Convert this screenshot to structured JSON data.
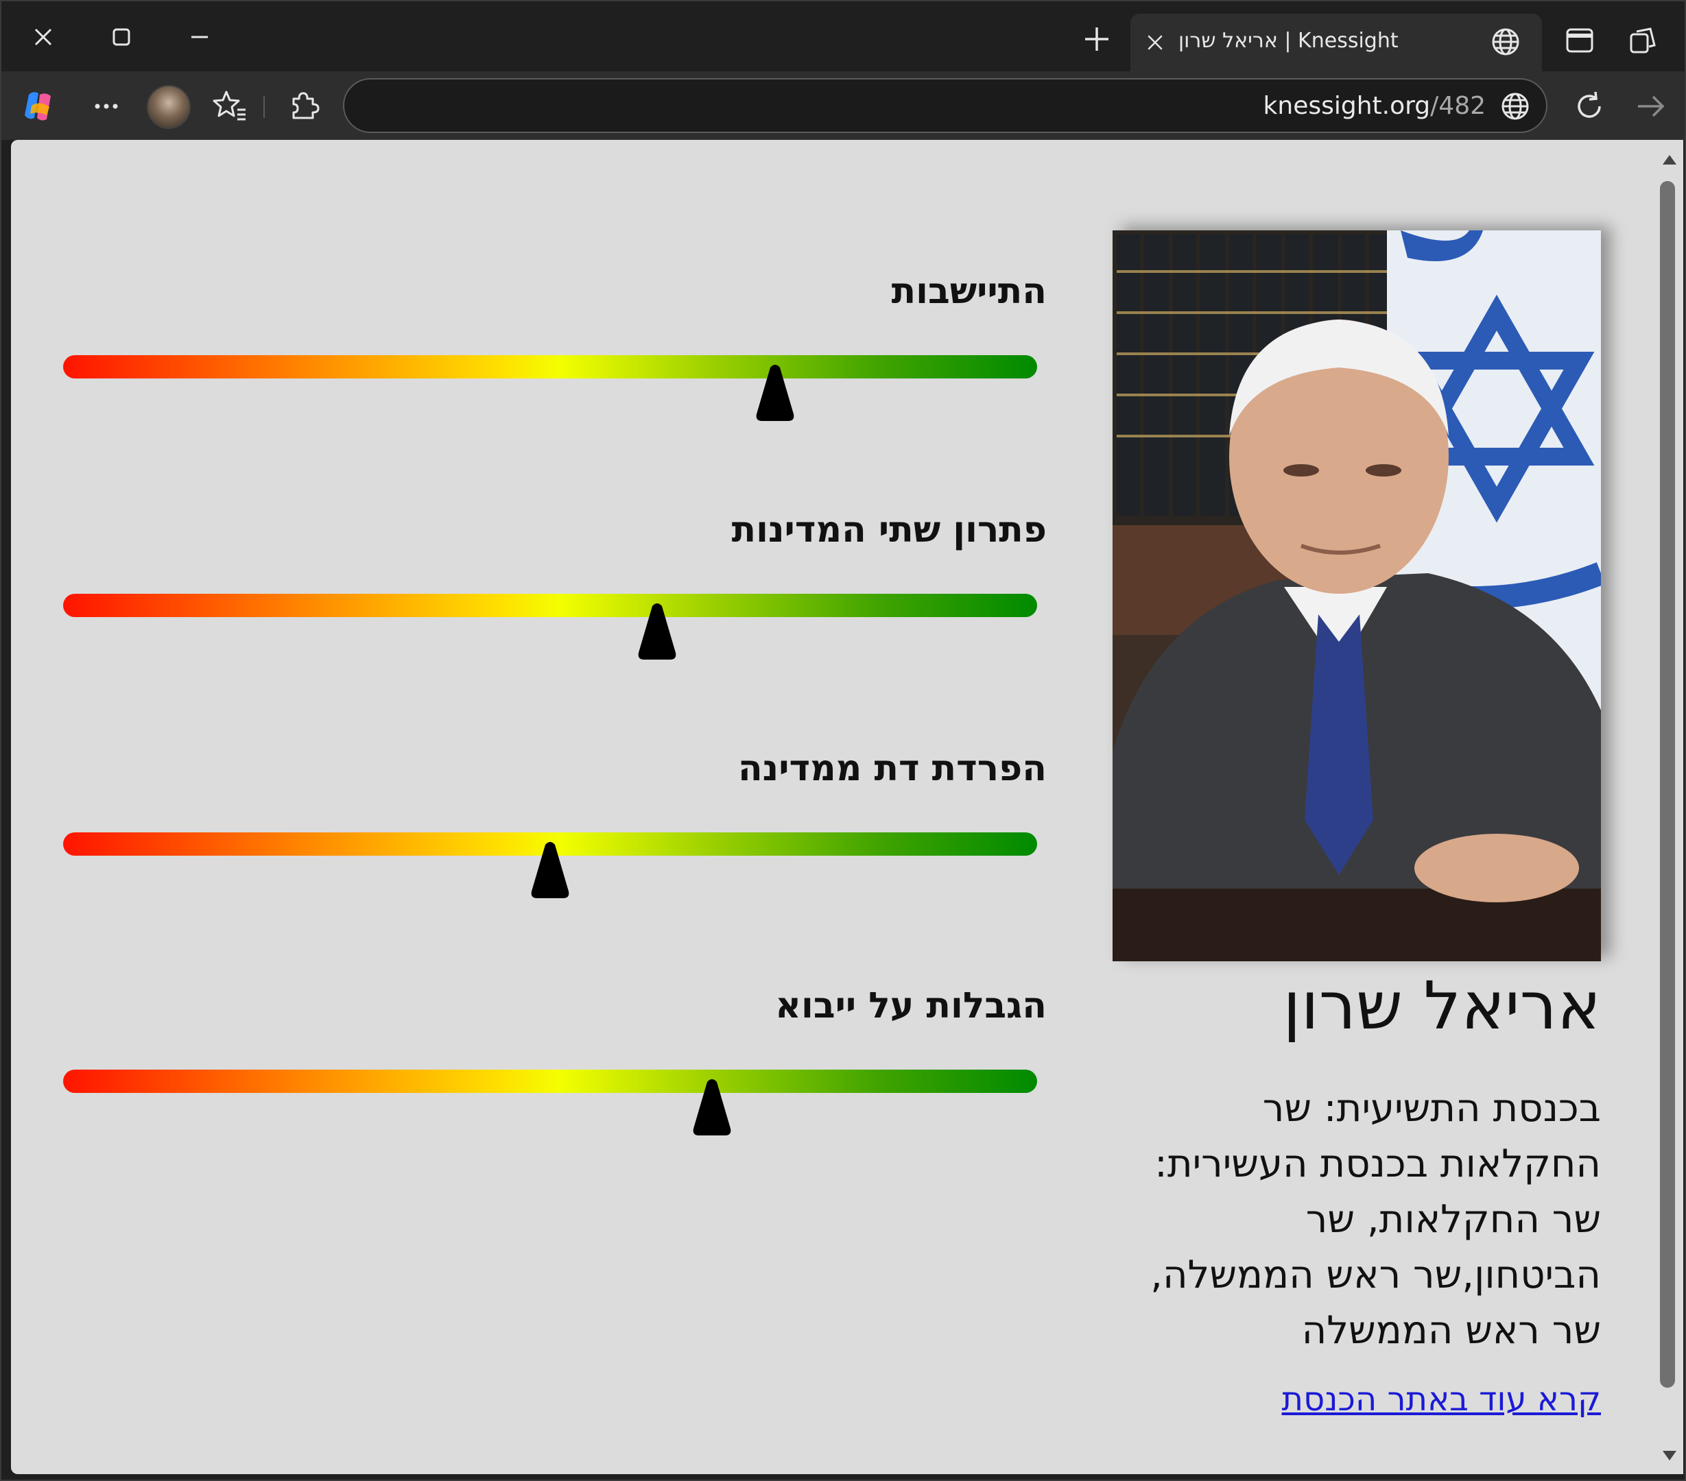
{
  "browser": {
    "tab_title": "אריאל שרון | Knessight",
    "url_domain": "knessight.org",
    "url_path": "/482",
    "accent": "#2e2e2e"
  },
  "profile": {
    "name": "אריאל שרון",
    "description": "בכנסת התשיעית: שר החקלאות בכנסת העשירית: שר החקלאות, שר הביטחון,שר ראש הממשלה, שר ראש הממשלה",
    "read_more": "קרא עוד באתר הכנסת"
  },
  "topics": [
    {
      "label": "התיישבות",
      "position": 0.731
    },
    {
      "label": "פתרון שתי המדינות",
      "position": 0.61
    },
    {
      "label": "הפרדת דת ממדינה",
      "position": 0.5
    },
    {
      "label": "הגבלות על ייבוא",
      "position": 0.666
    }
  ],
  "icons": [
    "close-icon",
    "maximize-icon",
    "minimize-icon",
    "new-tab-icon",
    "tab-close-icon",
    "globe-icon",
    "sidebar-icon",
    "workspaces-icon",
    "copilot-icon",
    "more-icon",
    "favorites-icon",
    "extensions-icon",
    "reload-icon",
    "forward-icon"
  ]
}
